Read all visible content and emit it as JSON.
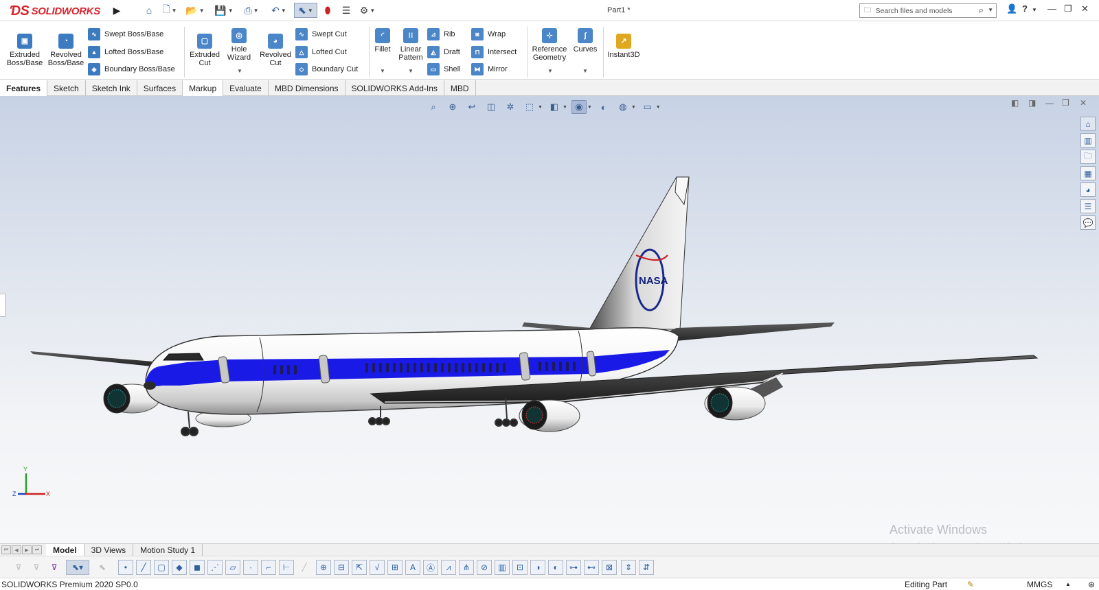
{
  "app": {
    "logo_text": "SOLIDWORKS",
    "doc_title": "Part1 *"
  },
  "search": {
    "placeholder": "Search files and models"
  },
  "quick_access": [
    "home-icon",
    "new-document-icon",
    "open-icon",
    "save-icon",
    "print-icon",
    "undo-icon",
    "select-icon",
    "rebuild-icon",
    "file-properties-icon",
    "options-icon"
  ],
  "ribbon": {
    "extruded_boss": "Extruded Boss/Base",
    "revolved_boss": "Revolved Boss/Base",
    "swept_boss": "Swept Boss/Base",
    "lofted_boss": "Lofted Boss/Base",
    "boundary_boss": "Boundary Boss/Base",
    "extruded_cut": "Extruded Cut",
    "hole_wizard": "Hole Wizard",
    "revolved_cut": "Revolved Cut",
    "swept_cut": "Swept Cut",
    "lofted_cut": "Lofted Cut",
    "boundary_cut": "Boundary Cut",
    "fillet": "Fillet",
    "linear_pattern": "Linear Pattern",
    "rib": "Rib",
    "draft": "Draft",
    "shell": "Shell",
    "wrap": "Wrap",
    "intersect": "Intersect",
    "mirror": "Mirror",
    "reference_geometry": "Reference Geometry",
    "curves": "Curves",
    "instant3d": "Instant3D"
  },
  "tabs": [
    "Features",
    "Sketch",
    "Sketch Ink",
    "Surfaces",
    "Markup",
    "Evaluate",
    "MBD Dimensions",
    "SOLIDWORKS Add-Ins",
    "MBD"
  ],
  "model": {
    "tail_logo": "NASA",
    "fuselage_color": "#ffffff",
    "stripe_color": "#1a1ae6"
  },
  "triad": {
    "x": "X",
    "y": "Y",
    "z": "Z"
  },
  "watermark": {
    "line1": "Activate Windows",
    "line2": "Go to Settings to activate Windows."
  },
  "bottom_tabs": [
    "Model",
    "3D Views",
    "Motion Study 1"
  ],
  "status": {
    "product": "SOLIDWORKS Premium 2020 SP0.0",
    "mode": "Editing Part",
    "units": "MMGS"
  }
}
